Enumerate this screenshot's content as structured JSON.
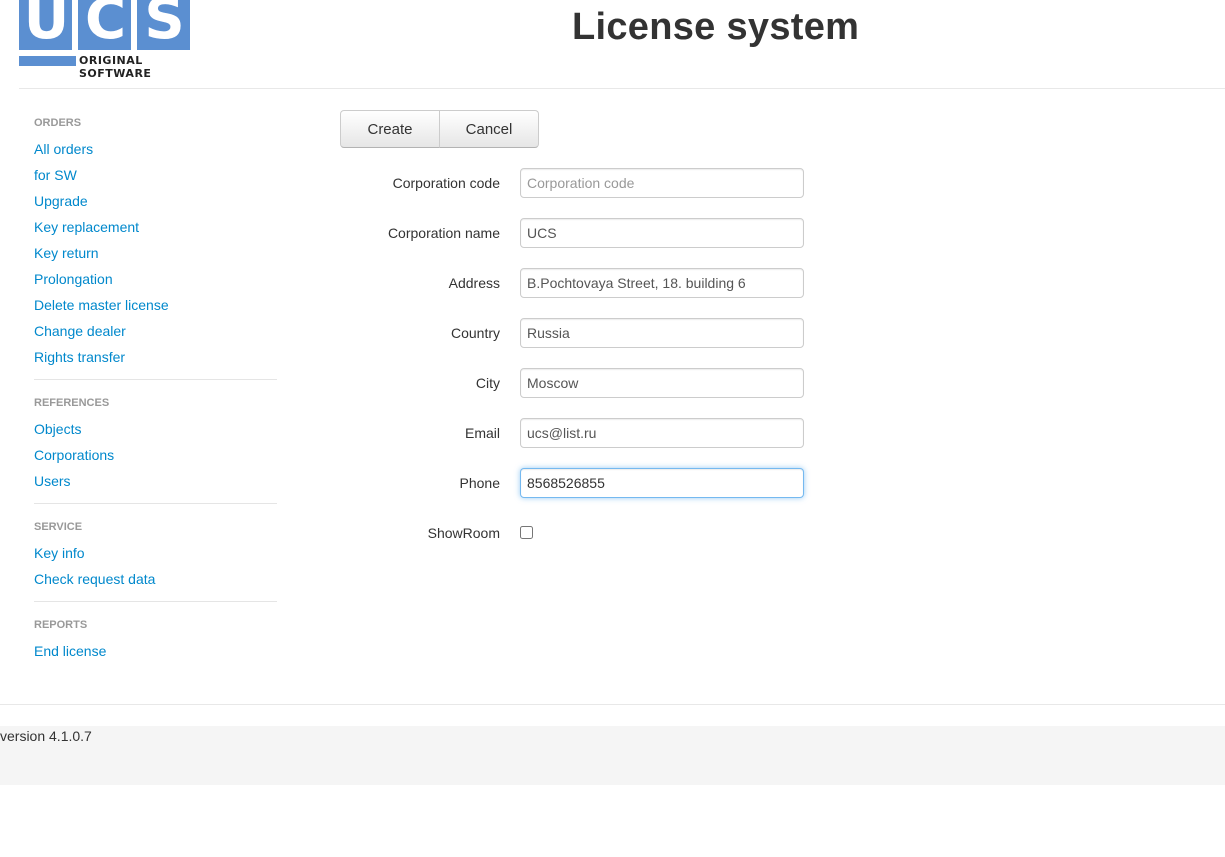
{
  "header": {
    "logo_text": "UCS",
    "logo_letters": [
      "U",
      "C",
      "S"
    ],
    "logo_tagline": "ORIGINAL SOFTWARE",
    "title": "License system",
    "brand_color": "#5b8fd1"
  },
  "sidebar": {
    "sections": [
      {
        "header": "ORDERS",
        "items": [
          "All orders",
          "for SW",
          "Upgrade",
          "Key replacement",
          "Key return",
          "Prolongation",
          "Delete master license",
          "Change dealer",
          "Rights transfer"
        ]
      },
      {
        "header": "REFERENCES",
        "items": [
          "Objects",
          "Corporations",
          "Users"
        ]
      },
      {
        "header": "SERVICE",
        "items": [
          "Key info",
          "Check request data"
        ]
      },
      {
        "header": "REPORTS",
        "items": [
          "End license"
        ]
      }
    ],
    "link_color": "#0088cc"
  },
  "toolbar": {
    "create_label": "Create",
    "cancel_label": "Cancel"
  },
  "form": {
    "corporation_code": {
      "label": "Corporation code",
      "value": "",
      "placeholder": "Corporation code"
    },
    "corporation_name": {
      "label": "Corporation name",
      "value": "UCS"
    },
    "address": {
      "label": "Address",
      "value": "B.Pochtovaya Street, 18. building 6"
    },
    "country": {
      "label": "Country",
      "value": "Russia"
    },
    "city": {
      "label": "City",
      "value": "Moscow"
    },
    "email": {
      "label": "Email",
      "value": "ucs@list.ru"
    },
    "phone": {
      "label": "Phone",
      "value": "8568526855"
    },
    "showroom": {
      "label": "ShowRoom",
      "checked": false
    }
  },
  "footer": {
    "version": "version 4.1.0.7"
  }
}
